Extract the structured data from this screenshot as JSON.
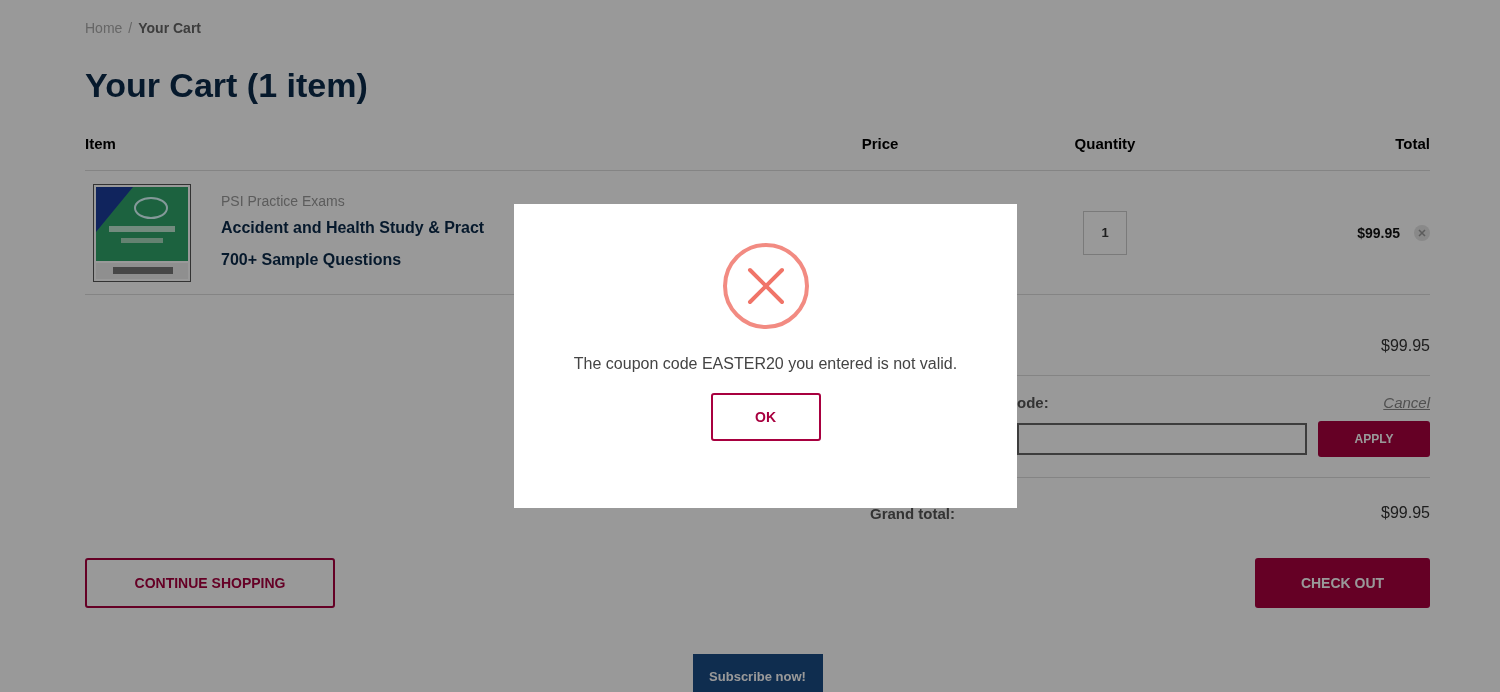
{
  "breadcrumb_separator": "/",
  "breadcrumb": [
    {
      "label": "Home",
      "current": false
    },
    {
      "label": "Your Cart",
      "current": true
    }
  ],
  "title": "Your Cart (1 item)",
  "columns": [
    "Item",
    "Price",
    "Quantity",
    "Total"
  ],
  "items": [
    {
      "kind": "picture",
      "vendor": "PSI Practice Exams",
      "name_lines": [
        "Accident and Health Study & Pract",
        "700+ Sample Questions"
      ],
      "quantity": "1",
      "total": "$99.95"
    }
  ],
  "summary": {
    "subtotal": "$99.95",
    "coupon_label": "ode:",
    "cancel": "Cancel",
    "apply": "APPLY",
    "grand_total_label": "Grand total:",
    "grand_total": "$99.95"
  },
  "continue_button": "CONTINUE SHOPPING",
  "checkout_button": "CHECK OUT",
  "subscribe_button": "Subscribe now!",
  "dialog": {
    "kind": "error",
    "message": "The coupon code EASTER20 you entered is not valid.",
    "ok": "OK"
  }
}
